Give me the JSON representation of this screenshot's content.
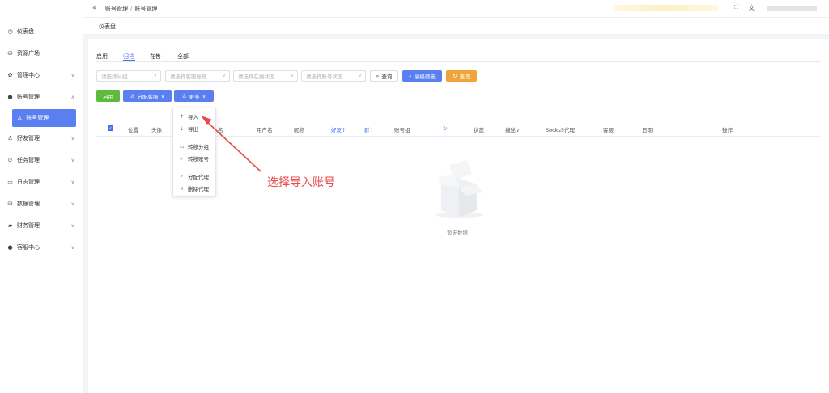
{
  "header": {
    "breadcrumb": [
      "账号管理",
      "账号管理"
    ],
    "icons": [
      "fullscreen-icon",
      "translate-icon"
    ]
  },
  "tags": {
    "dashboard": "仪表盘"
  },
  "sidebar": {
    "items": [
      {
        "label": "仪表盘",
        "icon": "dashboard-icon"
      },
      {
        "label": "资源广场",
        "icon": "database-icon"
      },
      {
        "label": "管理中心",
        "icon": "gear-icon"
      },
      {
        "label": "账号管理",
        "icon": "user-icon"
      },
      {
        "label": "好友管理",
        "icon": "user-icon"
      },
      {
        "label": "任务管理",
        "icon": "clock-icon"
      },
      {
        "label": "日志管理",
        "icon": "message-icon"
      },
      {
        "label": "数据管理",
        "icon": "database-icon"
      },
      {
        "label": "财务管理",
        "icon": "wallet-icon"
      },
      {
        "label": "客服中心",
        "icon": "user-icon"
      }
    ],
    "sub_item": "账号管理"
  },
  "tabs": [
    "启用",
    "归档",
    "在售",
    "全部"
  ],
  "filters": {
    "group": "请选择分组",
    "customer": "请选择客服账号",
    "online": "请选择在线状态",
    "account_status": "请选择账号状态"
  },
  "buttons": {
    "search": "查询",
    "advanced": "高级筛选",
    "reset": "重置",
    "enable": "启用",
    "assign": "分配客服",
    "more": "更多"
  },
  "table": {
    "headers": [
      "位置",
      "头像",
      "名",
      "用户名",
      "昵称",
      "好友↑",
      "群↑",
      "账号组",
      "状态",
      "描述∨",
      "Socks5代理",
      "客服",
      "日期",
      "操作"
    ],
    "empty_text": "暂无数据"
  },
  "dropdown": {
    "items": [
      "导入",
      "导出",
      "转移分组",
      "转移账号",
      "分配代理",
      "删除代理"
    ]
  },
  "annotation": {
    "text": "选择导入账号",
    "color": "#e84a4a"
  }
}
